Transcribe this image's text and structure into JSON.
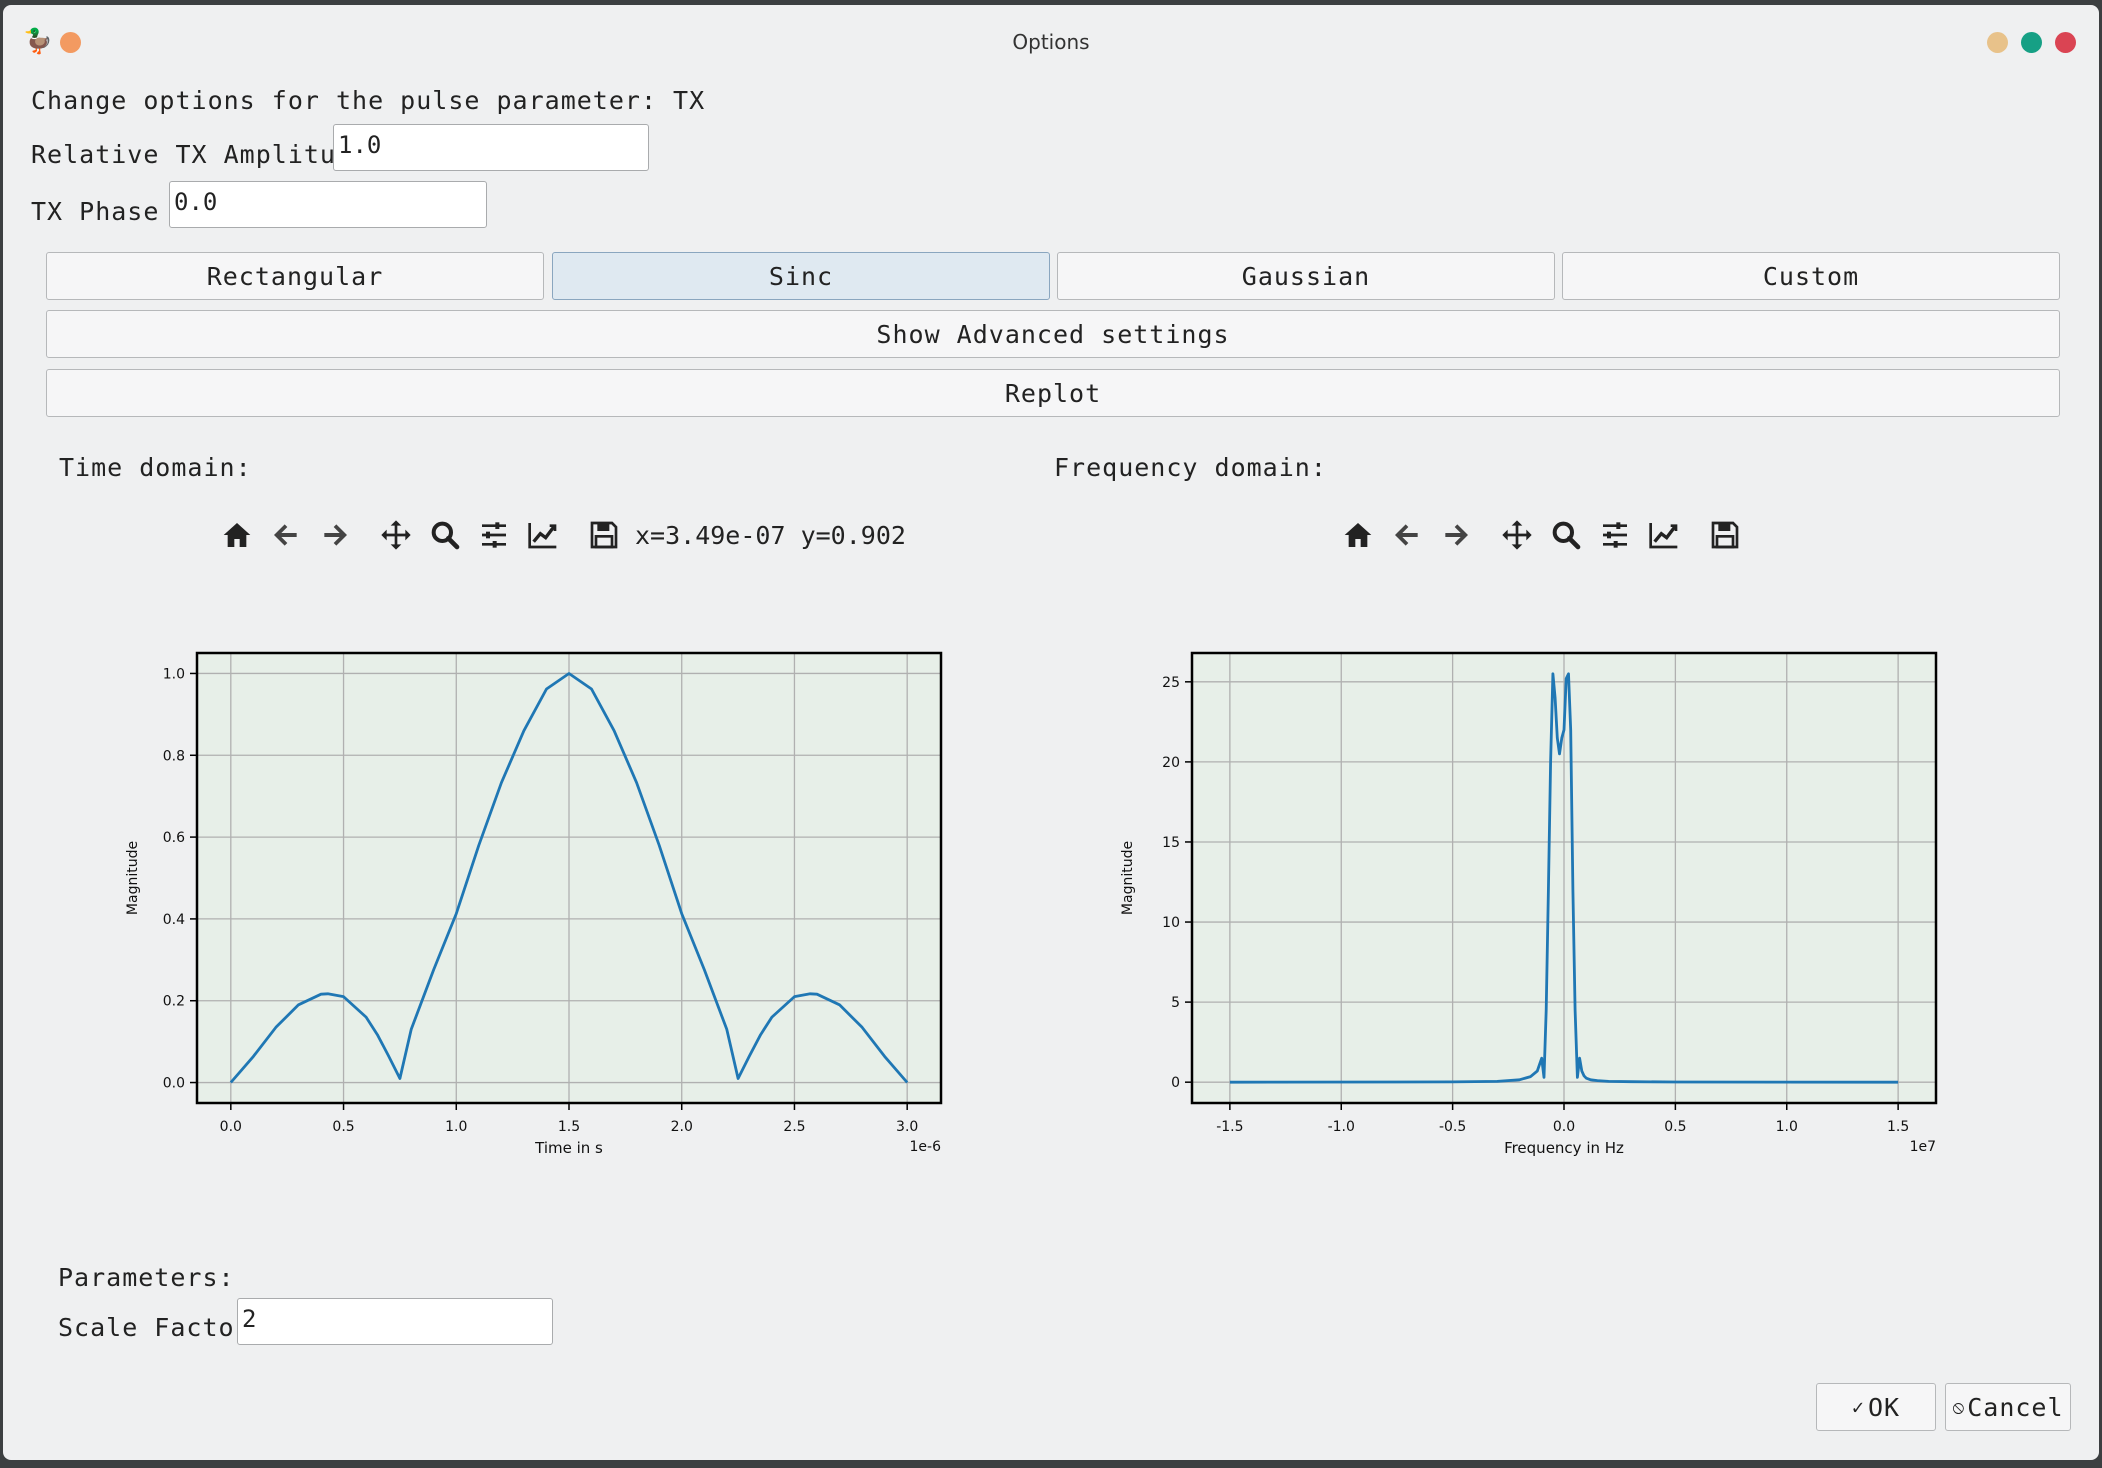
{
  "window": {
    "title": "Options"
  },
  "colors": {
    "plot_bg": "#e7efe8",
    "line": "#1f77b4",
    "grid": "#b0b0b0",
    "active_button": "#dfe9f1"
  },
  "header": {
    "text": "Change options for the pulse parameter: TX"
  },
  "amplitude": {
    "label": "Relative TX Amplitude",
    "value": "1.0"
  },
  "phase": {
    "label": "TX Phase",
    "value": "0.0"
  },
  "shape_buttons": [
    "Rectangular",
    "Sinc",
    "Gaussian",
    "Custom"
  ],
  "selected_shape": "Sinc",
  "advanced_button": "Show Advanced settings",
  "replot_button": "Replot",
  "time_domain": {
    "heading": "Time domain:",
    "coordinates": "x=3.49e-07 y=0.902",
    "toolbar_icons": [
      "home-icon",
      "back-arrow-icon",
      "forward-arrow-icon",
      "pan-icon",
      "zoom-icon",
      "configure-subplots-icon",
      "edit-axis-icon",
      "save-icon"
    ]
  },
  "frequency_domain": {
    "heading": "Frequency domain:",
    "toolbar_icons": [
      "home-icon",
      "back-arrow-icon",
      "forward-arrow-icon",
      "pan-icon",
      "zoom-icon",
      "configure-subplots-icon",
      "edit-axis-icon",
      "save-icon"
    ]
  },
  "parameters": {
    "heading": "Parameters:",
    "scale_label": "Scale Factor",
    "scale_value": "2"
  },
  "dialog_buttons": {
    "ok": "OK",
    "cancel": "Cancel"
  },
  "chart_data": [
    {
      "type": "line",
      "title": "",
      "xlabel": "Time in s",
      "ylabel": "Magnitude",
      "x_offset_label": "1e-6",
      "xlim": [
        -0.15,
        3.15
      ],
      "ylim": [
        -0.05,
        1.05
      ],
      "xticks": [
        0.0,
        0.5,
        1.0,
        1.5,
        2.0,
        2.5,
        3.0
      ],
      "xtick_labels": [
        "0.0",
        "0.5",
        "1.0",
        "1.5",
        "2.0",
        "2.5",
        "3.0"
      ],
      "yticks": [
        0.0,
        0.2,
        0.4,
        0.6,
        0.8,
        1.0
      ],
      "ytick_labels": [
        "0.0",
        "0.2",
        "0.4",
        "0.6",
        "0.8",
        "1.0"
      ],
      "grid": true,
      "series": [
        {
          "x": [
            0.0,
            0.1,
            0.2,
            0.3,
            0.4,
            0.43,
            0.5,
            0.6,
            0.65,
            0.7,
            0.75,
            0.8,
            0.9,
            1.0,
            1.1,
            1.2,
            1.3,
            1.4,
            1.5,
            1.6,
            1.7,
            1.8,
            1.9,
            2.0,
            2.1,
            2.2,
            2.25,
            2.3,
            2.35,
            2.4,
            2.5,
            2.57,
            2.6,
            2.7,
            2.8,
            2.9,
            3.0
          ],
          "y": [
            0.0,
            0.064,
            0.135,
            0.19,
            0.216,
            0.217,
            0.21,
            0.16,
            0.117,
            0.065,
            0.01,
            0.13,
            0.276,
            0.413,
            0.58,
            0.733,
            0.86,
            0.962,
            1.0,
            0.962,
            0.86,
            0.733,
            0.58,
            0.413,
            0.276,
            0.13,
            0.01,
            0.065,
            0.117,
            0.16,
            0.21,
            0.217,
            0.216,
            0.19,
            0.135,
            0.064,
            0.0
          ]
        }
      ]
    },
    {
      "type": "line",
      "title": "",
      "xlabel": "Frequency in Hz",
      "ylabel": "Magnitude",
      "x_offset_label": "1e7",
      "xlim": [
        -1.67,
        1.67
      ],
      "ylim": [
        -1.3,
        26.8
      ],
      "xticks": [
        -1.5,
        -1.0,
        -0.5,
        0.0,
        0.5,
        1.0,
        1.5
      ],
      "xtick_labels": [
        "-1.5",
        "-1.0",
        "-0.5",
        "0.0",
        "0.5",
        "1.0",
        "1.5"
      ],
      "yticks": [
        0,
        5,
        10,
        15,
        20,
        25
      ],
      "ytick_labels": [
        "0",
        "5",
        "10",
        "15",
        "20",
        "25"
      ],
      "grid": true,
      "series": [
        {
          "x": [
            -1.5,
            -0.5,
            -0.3,
            -0.2,
            -0.15,
            -0.12,
            -0.1,
            -0.09,
            -0.08,
            -0.07,
            -0.06,
            -0.05,
            -0.04,
            -0.03,
            -0.02,
            -0.01,
            0.0,
            0.01,
            0.02,
            0.03,
            0.04,
            0.05,
            0.06,
            0.07,
            0.08,
            0.09,
            0.1,
            0.12,
            0.15,
            0.2,
            0.3,
            0.5,
            1.5
          ],
          "y": [
            0.0,
            0.02,
            0.05,
            0.15,
            0.35,
            0.7,
            1.5,
            0.3,
            4.5,
            12.0,
            20.0,
            25.5,
            24.0,
            21.5,
            20.5,
            21.5,
            22.0,
            25.2,
            25.5,
            22.0,
            12.0,
            4.5,
            0.3,
            1.5,
            0.7,
            0.4,
            0.25,
            0.15,
            0.1,
            0.05,
            0.03,
            0.01,
            0.0
          ]
        }
      ]
    }
  ]
}
